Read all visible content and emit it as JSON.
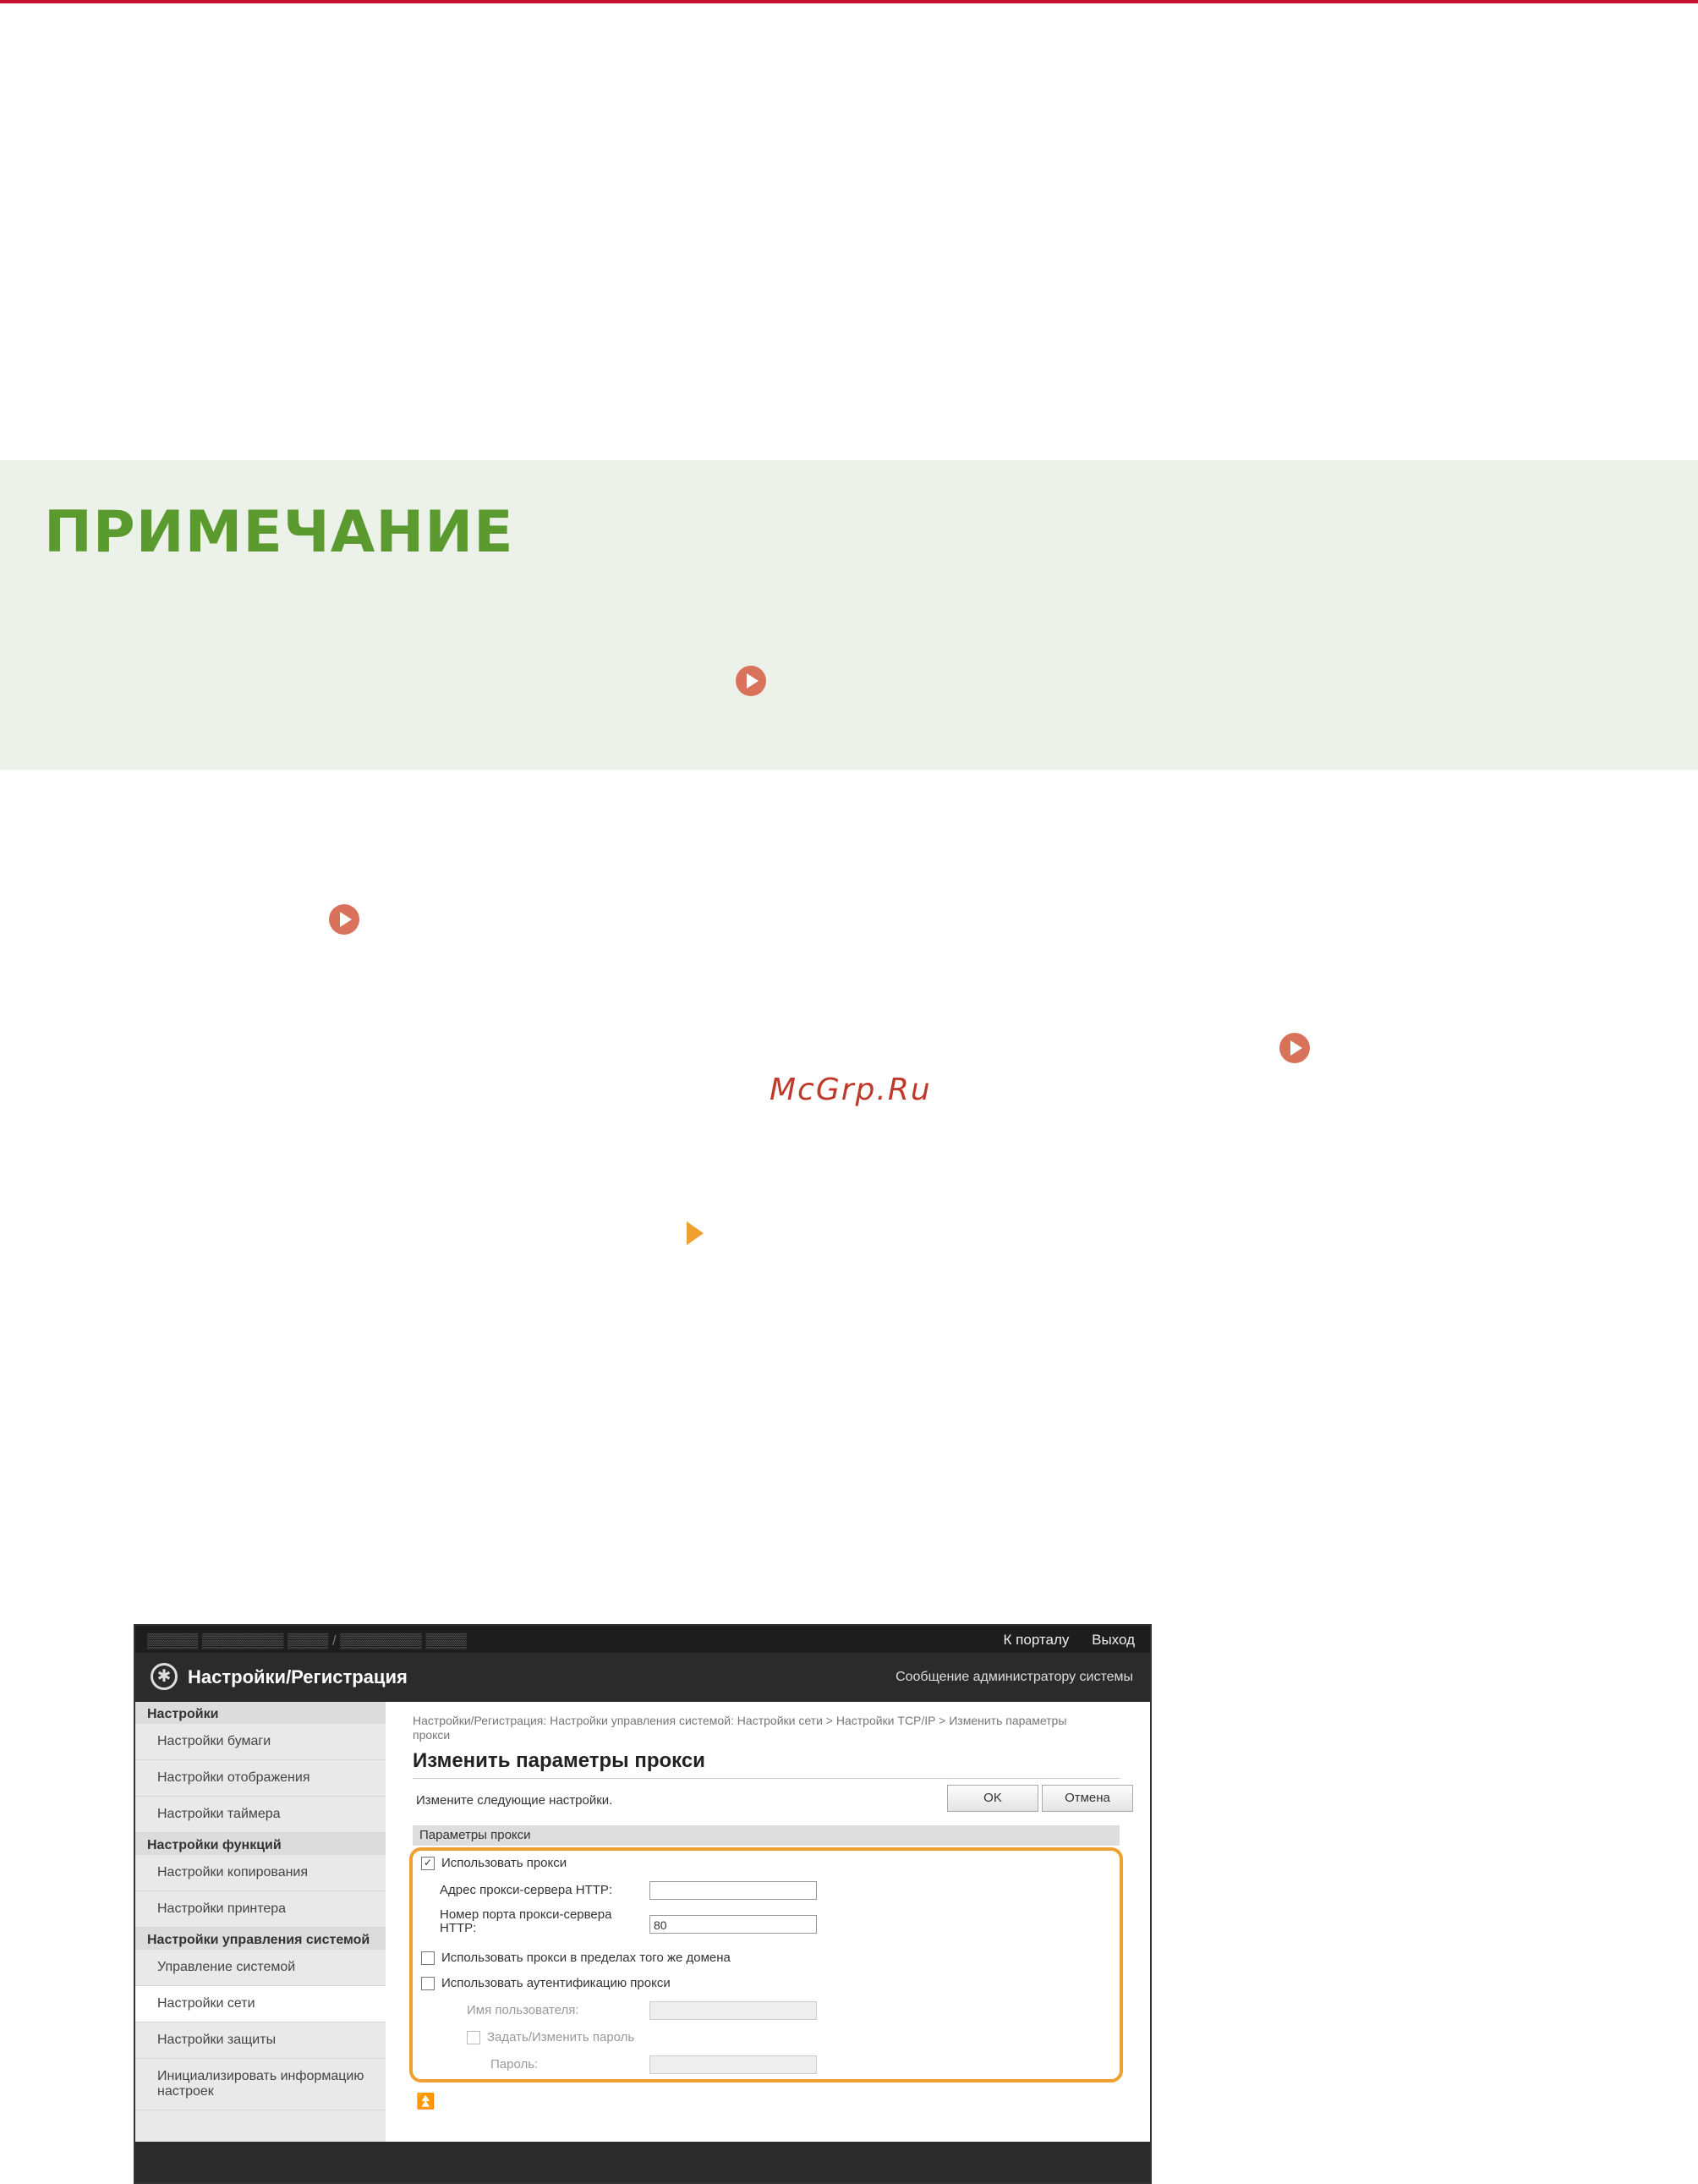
{
  "note": {
    "title": "ПРИМЕЧАНИЕ"
  },
  "watermark": "McGrp.Ru",
  "screenshot": {
    "topbar_links": [
      "К порталу",
      "Выход"
    ],
    "header": {
      "title": "Настройки/Регистрация",
      "admin_message": "Сообщение администратору системы"
    },
    "sidebar": [
      {
        "type": "group",
        "label": "Настройки"
      },
      {
        "type": "item",
        "label": "Настройки бумаги"
      },
      {
        "type": "item",
        "label": "Настройки отображения"
      },
      {
        "type": "item",
        "label": "Настройки таймера"
      },
      {
        "type": "group",
        "label": "Настройки функций"
      },
      {
        "type": "item",
        "label": "Настройки копирования"
      },
      {
        "type": "item",
        "label": "Настройки принтера"
      },
      {
        "type": "group",
        "label": "Настройки управления системой"
      },
      {
        "type": "item",
        "label": "Управление системой"
      },
      {
        "type": "item",
        "label": "Настройки сети",
        "active": true
      },
      {
        "type": "item",
        "label": "Настройки защиты"
      },
      {
        "type": "item",
        "label": "Инициализировать информацию настроек"
      }
    ],
    "main": {
      "breadcrumb": "Настройки/Регистрация: Настройки управления системой: Настройки сети > Настройки TCP/IP > Изменить параметры прокси",
      "title": "Изменить параметры прокси",
      "instruction": "Измените следующие настройки.",
      "ok_label": "OK",
      "cancel_label": "Отмена",
      "section_title": "Параметры прокси",
      "use_proxy_label": "Использовать прокси",
      "use_proxy_checked": true,
      "http_address_label": "Адрес прокси-сервера HTTP:",
      "http_address_value": "",
      "http_port_label_1": "Номер порта прокси-сервера",
      "http_port_label_2": "HTTP:",
      "http_port_value": "80",
      "same_domain_label": "Использовать прокси в пределах того же домена",
      "auth_label": "Использовать аутентификацию прокси",
      "username_label": "Имя пользователя:",
      "set_password_label": "Задать/Изменить пароль",
      "password_label": "Пароль:",
      "to_top_symbol": "⏫"
    }
  }
}
